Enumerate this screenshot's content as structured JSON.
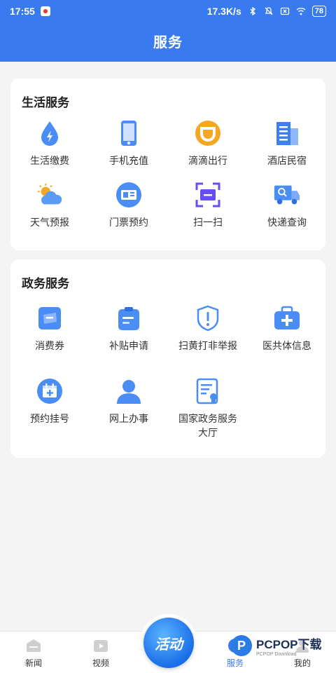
{
  "status_bar": {
    "time": "17:55",
    "net_speed": "17.3K/s",
    "battery": "78"
  },
  "header": {
    "title": "服务"
  },
  "life_services": {
    "title": "生活服务",
    "items": [
      {
        "label": "生活缴费",
        "icon": "water-drop-bolt-icon"
      },
      {
        "label": "手机充值",
        "icon": "phone-icon"
      },
      {
        "label": "滴滴出行",
        "icon": "didi-icon"
      },
      {
        "label": "酒店民宿",
        "icon": "hotel-building-icon"
      },
      {
        "label": "天气预报",
        "icon": "weather-icon"
      },
      {
        "label": "门票预约",
        "icon": "ticket-icon"
      },
      {
        "label": "扫一扫",
        "icon": "scan-icon"
      },
      {
        "label": "快递查询",
        "icon": "delivery-truck-icon"
      }
    ]
  },
  "gov_services": {
    "title": "政务服务",
    "items": [
      {
        "label": "消费券",
        "icon": "coupon-icon"
      },
      {
        "label": "补贴申请",
        "icon": "clipboard-icon"
      },
      {
        "label": "扫黄打非举报",
        "icon": "shield-alert-icon"
      },
      {
        "label": "医共体信息",
        "icon": "medical-kit-icon"
      },
      {
        "label": "预约挂号",
        "icon": "calendar-plus-icon"
      },
      {
        "label": "网上办事",
        "icon": "user-icon"
      },
      {
        "label": "国家政务服务大厅",
        "icon": "document-badge-icon"
      }
    ]
  },
  "tabbar": {
    "news": "新闻",
    "video": "视频",
    "activity": "活动",
    "service": "服务",
    "mine": "我的"
  },
  "watermark": {
    "brand": "PCPOP下载",
    "sub": "PCPOP Download"
  },
  "colors": {
    "primary": "#3a7af0",
    "background": "#f4f4f4"
  }
}
